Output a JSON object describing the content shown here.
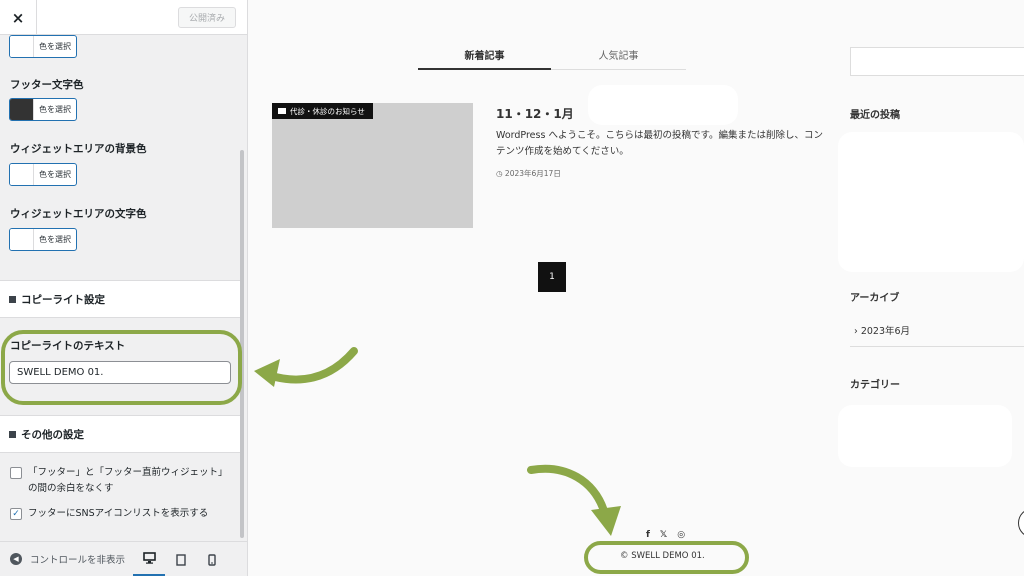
{
  "sidebar": {
    "close_icon": "×",
    "publish_label": "公開済み",
    "select_color_label": "色を選択",
    "footer_text_color_label": "フッター文字色",
    "widget_bg_color_label": "ウィジェットエリアの背景色",
    "widget_text_color_label": "ウィジェットエリアの文字色",
    "copyright_section": "コピーライト設定",
    "copyright_text_label": "コピーライトのテキスト",
    "copyright_text_value": "SWELL DEMO 01.",
    "other_section": "その他の設定",
    "remove_gap_label_1": "「フッター」と「フッター直前ウィジェット」",
    "remove_gap_label_2": "の間の余白をなくす",
    "remove_gap_checked": false,
    "sns_icons_label": "フッターにSNSアイコンリストを表示する",
    "sns_icons_checked": true,
    "hide_controls_label": "コントロールを非表示",
    "devices": [
      "desktop-icon",
      "tablet-icon",
      "mobile-icon"
    ],
    "active_device": "desktop"
  },
  "preview": {
    "tabs": [
      "新着記事",
      "人気記事"
    ],
    "post": {
      "category": "代診・休診のお知らせ",
      "title": "11・12・1月",
      "excerpt": "WordPress へようこそ。こちらは最初の投稿です。編集または削除し、コンテンツ作成を始めてください。",
      "date": "◷ 2023年6月17日"
    },
    "page_number": "1",
    "widgets": {
      "recent_posts": "最近の投稿",
      "archive": "アーカイブ",
      "archive_item": "›  2023年6月",
      "categories": "カテゴリー"
    },
    "sns": [
      "f",
      "𝕏",
      "◎"
    ],
    "copyright": "© SWELL DEMO 01."
  },
  "colors": {
    "accent": "#2271b1",
    "annotation": "#8ca848",
    "dark_swatch": "#333333"
  }
}
